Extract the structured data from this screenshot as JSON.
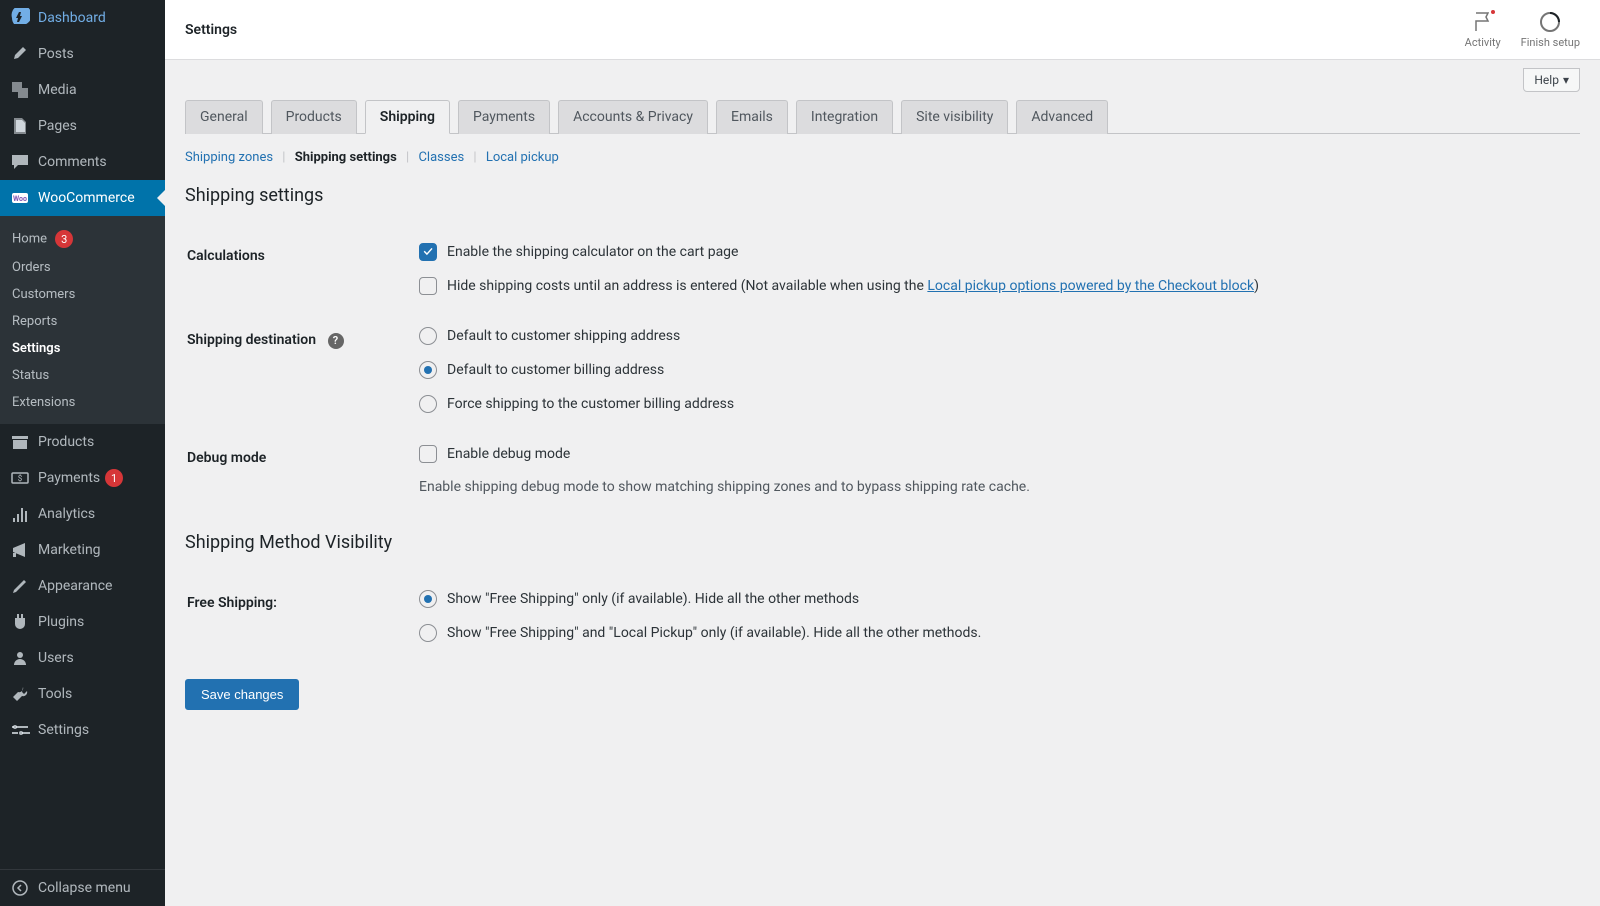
{
  "topbar": {
    "title": "Settings",
    "activity": "Activity",
    "finish_setup": "Finish setup"
  },
  "help_label": "Help",
  "sidebar": {
    "items": [
      {
        "label": "Dashboard",
        "icon": "dashboard"
      },
      {
        "label": "Posts",
        "icon": "pin"
      },
      {
        "label": "Media",
        "icon": "media"
      },
      {
        "label": "Pages",
        "icon": "pages"
      },
      {
        "label": "Comments",
        "icon": "comments"
      },
      {
        "label": "WooCommerce",
        "icon": "woo",
        "current": true,
        "submenu": [
          {
            "label": "Home",
            "badge": "3"
          },
          {
            "label": "Orders"
          },
          {
            "label": "Customers"
          },
          {
            "label": "Reports"
          },
          {
            "label": "Settings",
            "active": true
          },
          {
            "label": "Status"
          },
          {
            "label": "Extensions"
          }
        ]
      },
      {
        "label": "Products",
        "icon": "archive"
      },
      {
        "label": "Payments",
        "icon": "payments",
        "badge": "1"
      },
      {
        "label": "Analytics",
        "icon": "analytics"
      },
      {
        "label": "Marketing",
        "icon": "marketing"
      },
      {
        "label": "Appearance",
        "icon": "appearance"
      },
      {
        "label": "Plugins",
        "icon": "plugins"
      },
      {
        "label": "Users",
        "icon": "users"
      },
      {
        "label": "Tools",
        "icon": "tools"
      },
      {
        "label": "Settings",
        "icon": "settings"
      }
    ],
    "collapse": "Collapse menu"
  },
  "tabs": [
    "General",
    "Products",
    "Shipping",
    "Payments",
    "Accounts & Privacy",
    "Emails",
    "Integration",
    "Site visibility",
    "Advanced"
  ],
  "active_tab": 2,
  "subtabs": [
    "Shipping zones",
    "Shipping settings",
    "Classes",
    "Local pickup"
  ],
  "active_subtab": 1,
  "sections": {
    "heading1": "Shipping settings",
    "calculations": {
      "label": "Calculations",
      "opt1": "Enable the shipping calculator on the cart page",
      "opt2_pre": "Hide shipping costs until an address is entered (Not available when using the ",
      "opt2_link": "Local pickup options powered by the Checkout block",
      "opt2_post": ")"
    },
    "destination": {
      "label": "Shipping destination",
      "opt1": "Default to customer shipping address",
      "opt2": "Default to customer billing address",
      "opt3": "Force shipping to the customer billing address"
    },
    "debug": {
      "label": "Debug mode",
      "opt": "Enable debug mode",
      "desc": "Enable shipping debug mode to show matching shipping zones and to bypass shipping rate cache."
    },
    "heading2": "Shipping Method Visibility",
    "freeshipping": {
      "label": "Free Shipping:",
      "opt1": "Show \"Free Shipping\" only (if available). Hide all the other methods",
      "opt2": "Show \"Free Shipping\" and \"Local Pickup\" only (if available). Hide all the other methods."
    }
  },
  "save_label": "Save changes"
}
